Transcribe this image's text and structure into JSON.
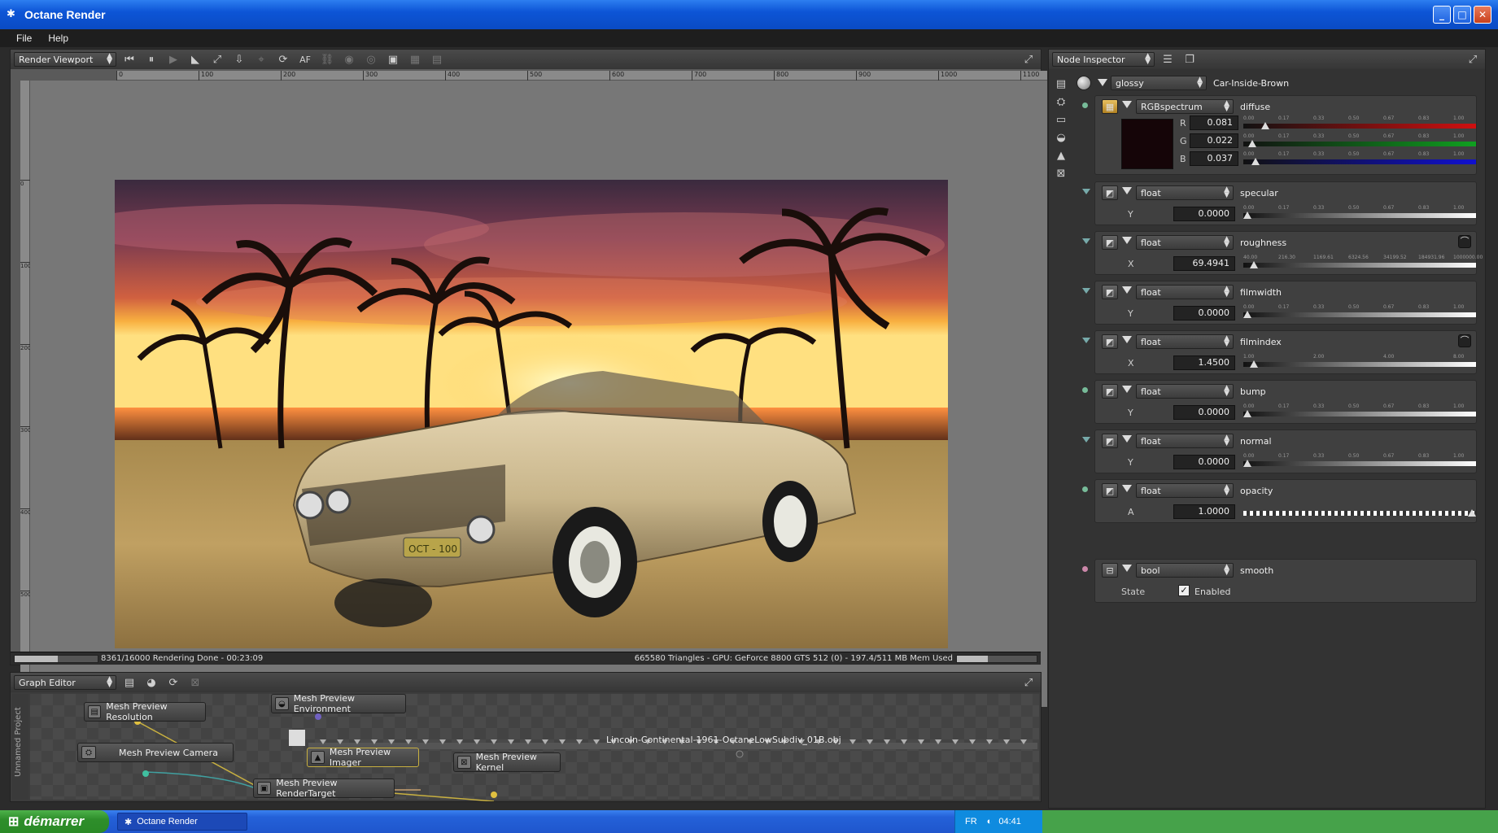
{
  "window": {
    "title": "Octane Render"
  },
  "menu": {
    "items": [
      "File",
      "Help"
    ]
  },
  "viewport": {
    "combo_label": "Render Viewport",
    "ruler_h": [
      "0",
      "100",
      "200",
      "300",
      "400",
      "500",
      "600",
      "700",
      "800",
      "900",
      "1000",
      "1100"
    ],
    "ruler_v": [
      "0",
      "100",
      "200",
      "300",
      "400",
      "500",
      "600"
    ],
    "af_label": "AF",
    "status_left": "8361/16000 Rendering Done - 00:23:09",
    "status_right": "665580 Triangles - GPU: GeForce 8800 GTS 512 (0) - 197.4/511 MB Mem Used",
    "render_progress": 0.52,
    "mem_progress": 0.39
  },
  "render_image": {
    "plate_text": "OCT - 100"
  },
  "inspector": {
    "combo_label": "Node Inspector",
    "material_type": "glossy",
    "material_name": "Car-Inside-Brown",
    "diffuse": {
      "type": "RGBspectrum",
      "label": "diffuse",
      "swatch_color": "#150508",
      "channels": [
        {
          "axis": "R",
          "value": "0.081",
          "v": 0.081,
          "color": "#d01010"
        },
        {
          "axis": "G",
          "value": "0.022",
          "v": 0.022,
          "color": "#10a020"
        },
        {
          "axis": "B",
          "value": "0.037",
          "v": 0.037,
          "color": "#1010d0"
        }
      ],
      "ticks": [
        "0.00",
        "0.17",
        "0.33",
        "0.50",
        "0.67",
        "0.83",
        "1.00"
      ]
    },
    "rows": [
      {
        "type": "float",
        "label": "specular",
        "axis": "Y",
        "value": "0.0000",
        "v": 0.0,
        "ticks": [
          "0.00",
          "0.17",
          "0.33",
          "0.50",
          "0.67",
          "0.83",
          "1.00"
        ],
        "pin": "tri",
        "pin_color": "#7aa"
      },
      {
        "type": "float",
        "label": "roughness",
        "axis": "X",
        "value": "69.4941",
        "v": 0.03,
        "ticks": [
          "40.00",
          "216.30",
          "1169.61",
          "6324.56",
          "34199.52",
          "184931.96",
          "1000000.00"
        ],
        "pin": "tri",
        "pin_color": "#7aa",
        "curve": true
      },
      {
        "type": "float",
        "label": "filmwidth",
        "axis": "Y",
        "value": "0.0000",
        "v": 0.0,
        "ticks": [
          "0.00",
          "0.17",
          "0.33",
          "0.50",
          "0.67",
          "0.83",
          "1.00"
        ],
        "pin": "tri",
        "pin_color": "#7aa"
      },
      {
        "type": "float",
        "label": "filmindex",
        "axis": "X",
        "value": "1.4500",
        "v": 0.03,
        "ticks": [
          "1.00",
          "2.00",
          "4.00",
          "8.00"
        ],
        "pin": "tri",
        "pin_color": "#7aa",
        "curve": true
      },
      {
        "type": "float",
        "label": "bump",
        "axis": "Y",
        "value": "0.0000",
        "v": 0.0,
        "ticks": [
          "0.00",
          "0.17",
          "0.33",
          "0.50",
          "0.67",
          "0.83",
          "1.00"
        ],
        "pin": "dot",
        "pin_color": "#7b9"
      },
      {
        "type": "float",
        "label": "normal",
        "axis": "Y",
        "value": "0.0000",
        "v": 0.0,
        "ticks": [
          "0.00",
          "0.17",
          "0.33",
          "0.50",
          "0.67",
          "0.83",
          "1.00"
        ],
        "pin": "tri",
        "pin_color": "#7aa"
      },
      {
        "type": "float",
        "label": "opacity",
        "axis": "A",
        "value": "1.0000",
        "v": 1.0,
        "ticks": [],
        "pin": "dot",
        "pin_color": "#7b9",
        "checker": true
      }
    ],
    "smooth": {
      "type": "bool",
      "label": "smooth",
      "state_label": "State",
      "check_label": "Enabled",
      "checked": true,
      "pin_color": "#c8a"
    }
  },
  "graph": {
    "combo_label": "Graph Editor",
    "side_label": "Unnamed Project",
    "nodes": {
      "resolution": "Mesh Preview Resolution",
      "environment": "Mesh Preview Environment",
      "camera": "Mesh Preview Camera",
      "imager": "Mesh Preview Imager",
      "kernel": "Mesh Preview Kernel",
      "rendertarget": "Mesh Preview RenderTarget"
    },
    "mesh_label": "Lincoln-Continental-1961-OctaneLowSubdiv_01B.obj"
  },
  "taskbar": {
    "start": "démarrer",
    "task": "Octane Render",
    "lang": "FR",
    "time": "04:41"
  }
}
